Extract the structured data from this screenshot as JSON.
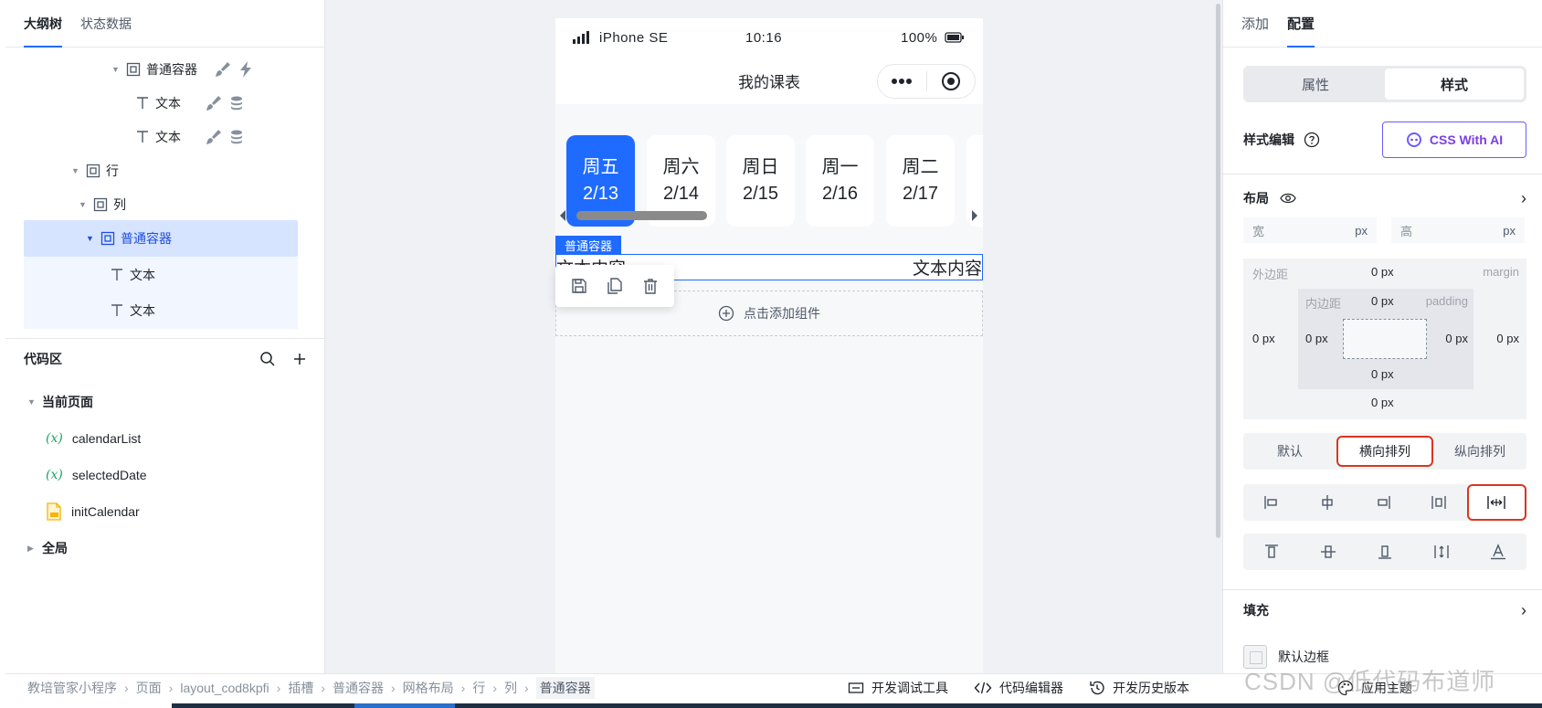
{
  "left": {
    "tabs": [
      "大纲树",
      "状态数据"
    ],
    "tree": [
      {
        "label": "普通容器",
        "actions": [
          "brush-icon",
          "bolt-icon"
        ]
      },
      {
        "label": "文本",
        "actions": [
          "brush-icon",
          "database-icon"
        ]
      },
      {
        "label": "文本",
        "actions": [
          "brush-icon",
          "database-icon"
        ]
      },
      {
        "label": "行"
      },
      {
        "label": "列"
      },
      {
        "label": "普通容器",
        "selected": true
      },
      {
        "label": "文本"
      },
      {
        "label": "文本"
      }
    ],
    "code": {
      "title": "代码区",
      "current_page": "当前页面",
      "var_icon": "(x)",
      "items": [
        "calendarList",
        "selectedDate",
        "initCalendar"
      ],
      "global": "全局"
    }
  },
  "phone": {
    "carrier": "iPhone SE",
    "time": "10:16",
    "battery": "100%",
    "page_title": "我的课表",
    "days": [
      {
        "week": "周五",
        "date": "2/13",
        "active": true
      },
      {
        "week": "周六",
        "date": "2/14"
      },
      {
        "week": "周日",
        "date": "2/15"
      },
      {
        "week": "周一",
        "date": "2/16"
      },
      {
        "week": "周二",
        "date": "2/17"
      }
    ],
    "container_tag": "普通容器",
    "text_left": "文本内容",
    "text_right": "文本内容",
    "add_component": "点击添加组件"
  },
  "right": {
    "tabs": [
      "添加",
      "配置"
    ],
    "segments": [
      "属性",
      "样式"
    ],
    "style_edit": "样式编辑",
    "ai_button": "CSS With AI",
    "layout": "布局",
    "width_label": "宽",
    "height_label": "高",
    "unit": "px",
    "margin_label": "外边距",
    "margin_en": "margin",
    "padding_label": "内边距",
    "padding_en": "padding",
    "value": "0 px",
    "directions": [
      "默认",
      "横向排列",
      "纵向排列"
    ],
    "fill": "填充",
    "default_border": "默认边框"
  },
  "bottom": {
    "breadcrumbs": [
      "教培管家小程序",
      "页面",
      "layout_cod8kpfi",
      "插槽",
      "普通容器",
      "网格布局",
      "行",
      "列",
      "普通容器"
    ],
    "tools": [
      "开发调试工具",
      "代码编辑器",
      "开发历史版本"
    ],
    "theme": "应用主题",
    "watermark": "CSDN @低代码布道师"
  },
  "colors": {
    "accent": "#1f6bff",
    "highlight_border": "#d9361e",
    "ai": "#7b3fe4"
  }
}
